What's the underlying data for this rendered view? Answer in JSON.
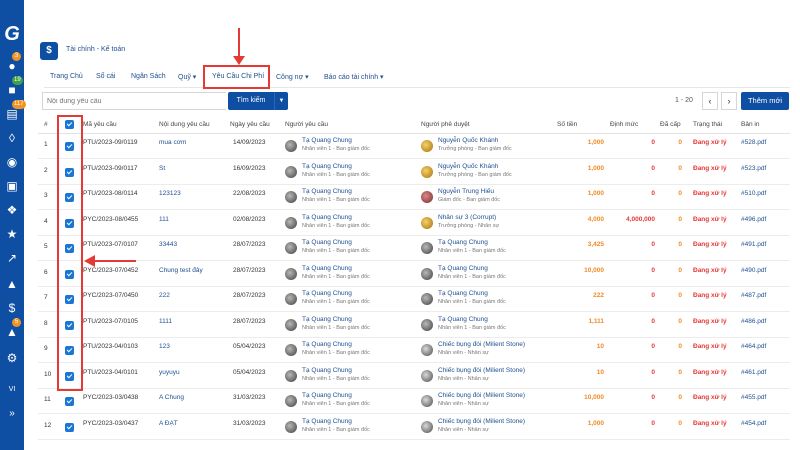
{
  "sidebar": {
    "badges": [
      "3",
      "19",
      "117",
      "5"
    ],
    "footer_text": "VI",
    "expand_icon": "»"
  },
  "module": {
    "icon": "$",
    "title": "Tài chính - Kế toán"
  },
  "nav": {
    "items": [
      "Trang Chủ",
      "Sổ cái",
      "Ngân Sách",
      "Quỹ ▾",
      "Yêu Cầu Chi Phí",
      "Công nợ ▾",
      "Báo cáo tài chính ▾"
    ]
  },
  "search": {
    "placeholder": "Nội dung yêu cầu",
    "button": "Tìm kiếm",
    "dropdown": "▼"
  },
  "pager": {
    "range": "1 - 20",
    "prev": "‹",
    "next": "›",
    "new_button": "Thêm mới"
  },
  "table": {
    "headers": [
      "#",
      "",
      "Mã yêu cầu",
      "Nội dung yêu cầu",
      "Ngày yêu cầu",
      "Người yêu cầu",
      "Người phê duyệt",
      "Số tiền",
      "Định mức",
      "Đã cấp",
      "Trạng thái",
      "Bản in"
    ],
    "rows": [
      {
        "num": "1",
        "code": "PTU/2023-09/0119",
        "desc": "mua cơm",
        "date": "14/09/2023",
        "req_name": "Tạ Quang Chung",
        "req_role": "Nhân viên 1 - Ban giám đốc",
        "app_name": "Nguyễn Quốc Khánh",
        "app_role": "Trưởng phòng - Ban giám đốc",
        "amount": "1,000",
        "quota": "0",
        "paid": "0",
        "status": "Đang xử lý",
        "pdf": "#528.pdf"
      },
      {
        "num": "2",
        "code": "PTU/2023-09/0117",
        "desc": "St",
        "date": "16/09/2023",
        "req_name": "Tạ Quang Chung",
        "req_role": "Nhân viên 1 - Ban giám đốc",
        "app_name": "Nguyễn Quốc Khánh",
        "app_role": "Trưởng phòng - Ban giám đốc",
        "amount": "1,000",
        "quota": "0",
        "paid": "0",
        "status": "Đang xử lý",
        "pdf": "#523.pdf"
      },
      {
        "num": "3",
        "code": "PTU/2023-08/0114",
        "desc": "123123",
        "date": "22/08/2023",
        "req_name": "Tạ Quang Chung",
        "req_role": "Nhân viên 1 - Ban giám đốc",
        "app_name": "Nguyễn Trung Hiếu",
        "app_role": "Giám đốc - Ban giám đốc",
        "amount": "1,000",
        "quota": "0",
        "paid": "0",
        "status": "Đang xử lý",
        "pdf": "#510.pdf"
      },
      {
        "num": "4",
        "code": "PYC/2023-08/0455",
        "desc": "111",
        "date": "02/08/2023",
        "req_name": "Tạ Quang Chung",
        "req_role": "Nhân viên 1 - Ban giám đốc",
        "app_name": "Nhân sự 3 (Corrupt)",
        "app_role": "Trưởng phòng - Nhân sự",
        "amount": "4,000",
        "quota": "4,000,000",
        "paid": "0",
        "status": "Đang xử lý",
        "pdf": "#496.pdf"
      },
      {
        "num": "5",
        "code": "PTU/2023-07/0107",
        "desc": "33443",
        "date": "28/07/2023",
        "req_name": "Tạ Quang Chung",
        "req_role": "Nhân viên 1 - Ban giám đốc",
        "app_name": "Tạ Quang Chung",
        "app_role": "Nhân viên 1 - Ban giám đốc",
        "amount": "3,425",
        "quota": "0",
        "paid": "0",
        "status": "Đang xử lý",
        "pdf": "#491.pdf"
      },
      {
        "num": "6",
        "code": "PYC/2023-07/0452",
        "desc": "Chung test đây",
        "date": "28/07/2023",
        "req_name": "Tạ Quang Chung",
        "req_role": "Nhân viên 1 - Ban giám đốc",
        "app_name": "Tạ Quang Chung",
        "app_role": "Nhân viên 1 - Ban giám đốc",
        "amount": "10,000",
        "quota": "0",
        "paid": "0",
        "status": "Đang xử lý",
        "pdf": "#490.pdf"
      },
      {
        "num": "7",
        "code": "PYC/2023-07/0450",
        "desc": "222",
        "date": "28/07/2023",
        "req_name": "Tạ Quang Chung",
        "req_role": "Nhân viên 1 - Ban giám đốc",
        "app_name": "Tạ Quang Chung",
        "app_role": "Nhân viên 1 - Ban giám đốc",
        "amount": "222",
        "quota": "0",
        "paid": "0",
        "status": "Đang xử lý",
        "pdf": "#487.pdf"
      },
      {
        "num": "8",
        "code": "PTU/2023-07/0105",
        "desc": "1111",
        "date": "28/07/2023",
        "req_name": "Tạ Quang Chung",
        "req_role": "Nhân viên 1 - Ban giám đốc",
        "app_name": "Tạ Quang Chung",
        "app_role": "Nhân viên 1 - Ban giám đốc",
        "amount": "1,111",
        "quota": "0",
        "paid": "0",
        "status": "Đang xử lý",
        "pdf": "#486.pdf"
      },
      {
        "num": "9",
        "code": "PTU/2023-04/0103",
        "desc": "123",
        "date": "05/04/2023",
        "req_name": "Tạ Quang Chung",
        "req_role": "Nhân viên 1 - Ban giám đốc",
        "app_name": "Chiếc bụng đói (Milient Stone)",
        "app_role": "Nhân viên - Nhân sự",
        "amount": "10",
        "quota": "0",
        "paid": "0",
        "status": "Đang xử lý",
        "pdf": "#464.pdf"
      },
      {
        "num": "10",
        "code": "PTU/2023-04/0101",
        "desc": "yuyuyu",
        "date": "05/04/2023",
        "req_name": "Tạ Quang Chung",
        "req_role": "Nhân viên 1 - Ban giám đốc",
        "app_name": "Chiếc bụng đói (Milient Stone)",
        "app_role": "Nhân viên - Nhân sự",
        "amount": "10",
        "quota": "0",
        "paid": "0",
        "status": "Đang xử lý",
        "pdf": "#461.pdf"
      },
      {
        "num": "11",
        "code": "PYC/2023-03/0438",
        "desc": "A Chung",
        "date": "31/03/2023",
        "req_name": "Tạ Quang Chung",
        "req_role": "Nhân viên 1 - Ban giám đốc",
        "app_name": "Chiếc bụng đói (Milient Stone)",
        "app_role": "Nhân viên - Nhân sự",
        "amount": "10,000",
        "quota": "0",
        "paid": "0",
        "status": "Đang xử lý",
        "pdf": "#455.pdf"
      },
      {
        "num": "12",
        "code": "PYC/2023-03/0437",
        "desc": "A ĐẠT",
        "date": "31/03/2023",
        "req_name": "Tạ Quang Chung",
        "req_role": "Nhân viên 1 - Ban giám đốc",
        "app_name": "Chiếc bụng đói (Milient Stone)",
        "app_role": "Nhân viên - Nhân sự",
        "amount": "1,000",
        "quota": "0",
        "paid": "0",
        "status": "Đang xử lý",
        "pdf": "#454.pdf"
      }
    ]
  },
  "colors": {
    "sidebar": "#0f4fa3",
    "accent": "#f29423",
    "annotation": "#e53935",
    "link": "#1f4f8f"
  }
}
